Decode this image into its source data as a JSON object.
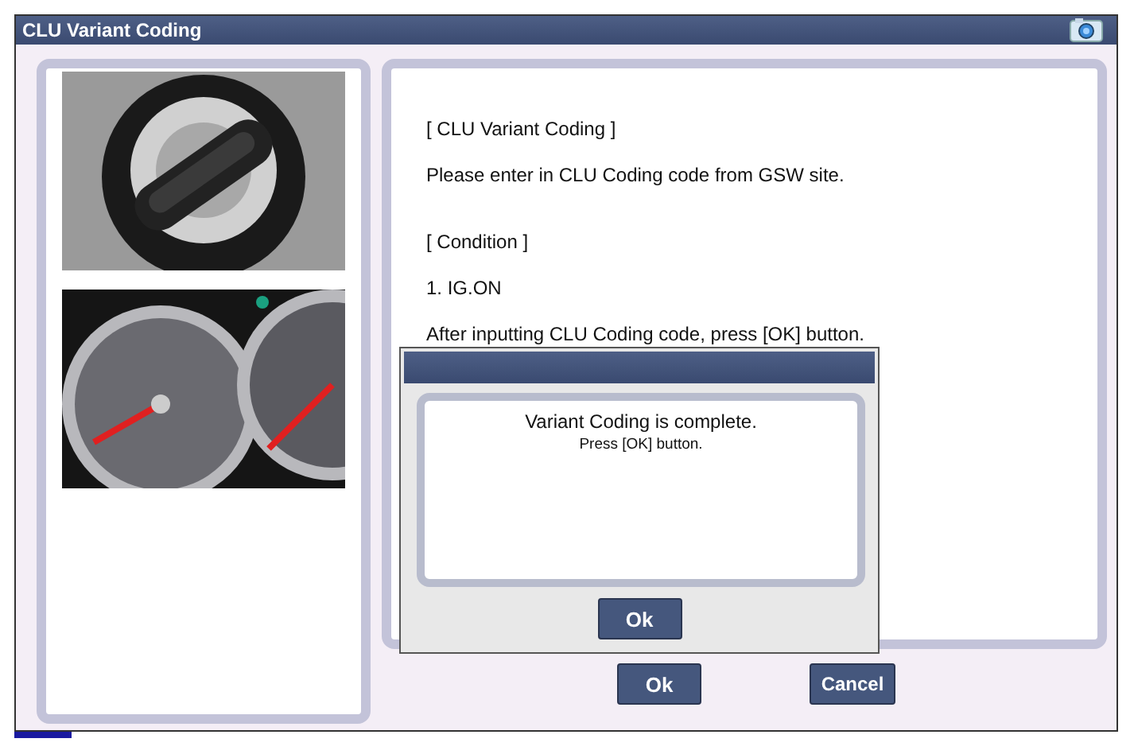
{
  "window": {
    "title": "CLU Variant Coding"
  },
  "content": {
    "sections": [
      {
        "lines": [
          "[ CLU Variant Coding ]",
          "Please enter in  CLU Coding code from GSW site."
        ]
      },
      {
        "lines": [
          "[ Condition ]",
          "1. IG.ON",
          "After inputting CLU Coding code, press [OK] button."
        ]
      }
    ]
  },
  "buttons": [
    {
      "label": "Ok"
    },
    {
      "label": "Cancel"
    }
  ],
  "dialog": {
    "message": "Variant Coding is complete.",
    "detail": "Press [OK] button.",
    "button": "Ok"
  }
}
